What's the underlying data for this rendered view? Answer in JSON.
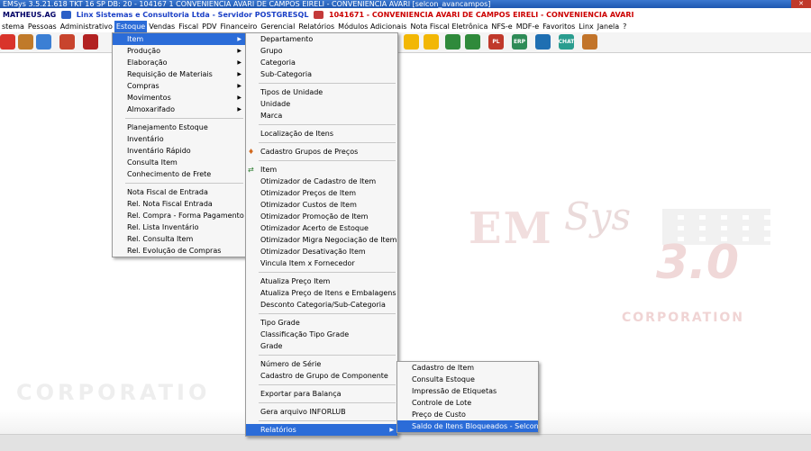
{
  "titlebar": {
    "text": "EMSys 3.5.21.618 TKT 16 SP DB: 20 - 104167 1 CONVENIENCIA AVARI DE CAMPOS EIRELI - CONVENIENCIA AVARI [selcon_avancampos]"
  },
  "infobar": {
    "user": "MATHEUS.AG",
    "company": "Linx Sistemas e Consultoria Ltda - Servidor POSTGRESQL",
    "order": "1041671 - CONVENIENCIA AVARI DE CAMPOS EIRELI - CONVENIENCIA AVARI"
  },
  "menubar": [
    "stema",
    "Pessoas",
    "Administrativo",
    "Estoque",
    "Vendas",
    "Fiscal",
    "PDV",
    "Financeiro",
    "Gerencial",
    "Relatórios",
    "Módulos Adicionais",
    "Nota Fiscal Eletrônica",
    "NFS-e",
    "MDF-e",
    "Favoritos",
    "Linx",
    "Janela",
    "?"
  ],
  "estoque_menu": [
    {
      "label": "Item",
      "arrow": true,
      "selected": true
    },
    {
      "label": "Produção",
      "arrow": true
    },
    {
      "label": "Elaboração",
      "arrow": true
    },
    {
      "label": "Requisição de Materiais",
      "arrow": true
    },
    {
      "label": "Compras",
      "arrow": true
    },
    {
      "label": "Movimentos",
      "arrow": true
    },
    {
      "label": "Almoxarifado",
      "arrow": true
    },
    {
      "sep": true
    },
    {
      "label": "Planejamento Estoque"
    },
    {
      "label": "Inventário"
    },
    {
      "label": "Inventário Rápido"
    },
    {
      "label": "Consulta Item"
    },
    {
      "label": "Conhecimento de Frete"
    },
    {
      "sep": true
    },
    {
      "label": "Nota Fiscal de Entrada"
    },
    {
      "label": "Rel. Nota Fiscal Entrada"
    },
    {
      "label": "Rel. Compra - Forma Pagamento"
    },
    {
      "label": "Rel. Lista Inventário"
    },
    {
      "label": "Rel. Consulta Item"
    },
    {
      "label": "Rel. Evolução de Compras"
    }
  ],
  "item_menu": [
    {
      "label": "Departamento"
    },
    {
      "label": "Grupo"
    },
    {
      "label": "Categoria"
    },
    {
      "label": "Sub-Categoria"
    },
    {
      "sep": true
    },
    {
      "label": "Tipos de Unidade"
    },
    {
      "label": "Unidade"
    },
    {
      "label": "Marca"
    },
    {
      "sep": true
    },
    {
      "label": "Localização de Itens"
    },
    {
      "sep": true
    },
    {
      "label": "Cadastro Grupos de Preços",
      "icon": "♦"
    },
    {
      "sep": true
    },
    {
      "label": "Item",
      "icon": "⇄"
    },
    {
      "label": "Otimizador de Cadastro de Item"
    },
    {
      "label": "Otimizador Preços de Item"
    },
    {
      "label": "Otimizador Custos de Item"
    },
    {
      "label": "Otimizador Promoção de Item"
    },
    {
      "label": "Otimizador Acerto de Estoque"
    },
    {
      "label": "Otimizador Migra Negociação de Item"
    },
    {
      "label": "Otimizador Desativação Item"
    },
    {
      "label": "Vincula Item x Fornecedor"
    },
    {
      "sep": true
    },
    {
      "label": "Atualiza Preço Item"
    },
    {
      "label": "Atualiza Preço de Itens e Embalagens"
    },
    {
      "label": "Desconto Categoria/Sub-Categoria"
    },
    {
      "sep": true
    },
    {
      "label": "Tipo Grade"
    },
    {
      "label": "Classificação Tipo Grade"
    },
    {
      "label": "Grade"
    },
    {
      "sep": true
    },
    {
      "label": "Número de Série"
    },
    {
      "label": "Cadastro de Grupo de Componente"
    },
    {
      "sep": true
    },
    {
      "label": "Exportar para Balança"
    },
    {
      "sep": true
    },
    {
      "label": "Gera arquivo INFORLUB"
    },
    {
      "sep": true
    },
    {
      "label": "Relatórios",
      "arrow": true,
      "selected": true
    }
  ],
  "relatorios_menu": [
    {
      "label": "Cadastro de Item"
    },
    {
      "label": "Consulta Estoque"
    },
    {
      "label": "Impressão de Etiquetas"
    },
    {
      "label": "Controle de Lote"
    },
    {
      "label": "Preço de Custo"
    },
    {
      "label": "Saldo de Itens Bloqueados - Selcon",
      "selected": true
    }
  ],
  "background": {
    "brand": "EM",
    "brand_script": "Sys",
    "version": "3.0",
    "corp_right": "CORPORATION",
    "corp_left": "CORPORATIO"
  },
  "toolbar_icons": [
    {
      "name": "power-icon",
      "color": "#d9342b",
      "label": ""
    },
    {
      "name": "people-icon",
      "color": "#c07a2a",
      "label": ""
    },
    {
      "name": "user-icon",
      "color": "#3b7fd4",
      "label": ""
    },
    {
      "name": "home-icon",
      "color": "#c8442d",
      "label": ""
    },
    {
      "name": "camera-icon",
      "color": "#b22222",
      "label": ""
    },
    {
      "name": "smile-icon",
      "color": "#f2b705",
      "label": ""
    },
    {
      "name": "smile2-icon",
      "color": "#f2b705",
      "label": ""
    },
    {
      "name": "money-icon",
      "color": "#2f8a3b",
      "label": ""
    },
    {
      "name": "money2-icon",
      "color": "#2f8a3b",
      "label": ""
    },
    {
      "name": "pl-icon",
      "color": "#c0392b",
      "label": "PL"
    },
    {
      "name": "erp-icon",
      "color": "#2e8b57",
      "label": "ERP"
    },
    {
      "name": "monitor-icon",
      "color": "#1f6fb2",
      "label": ""
    },
    {
      "name": "chat-icon",
      "color": "#2a9d8f",
      "label": "CHAT"
    },
    {
      "name": "gift-icon",
      "color": "#c2742a",
      "label": ""
    }
  ]
}
